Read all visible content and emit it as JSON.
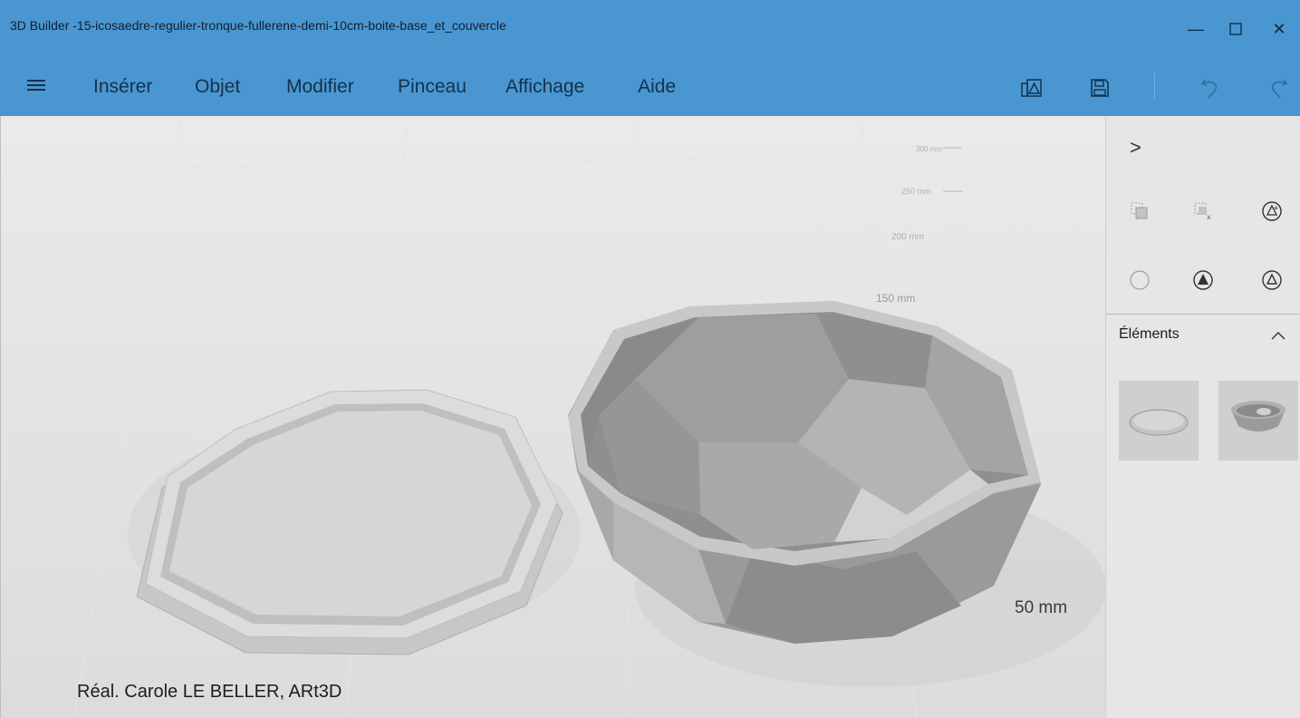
{
  "window": {
    "title": "3D Builder -15-icosaedre-regulier-tronque-fullerene-demi-10cm-boite-base_et_couvercle",
    "minimize_glyph": "—",
    "maximize_glyph": "☐",
    "close_glyph": "✕"
  },
  "menu": {
    "items": [
      {
        "label": "Insérer"
      },
      {
        "label": "Objet"
      },
      {
        "label": "Modifier"
      },
      {
        "label": "Pinceau"
      },
      {
        "label": "Affichage"
      },
      {
        "label": "Aide"
      }
    ],
    "tools": [
      "print-3d-icon",
      "save-icon",
      "undo-icon",
      "redo-icon"
    ]
  },
  "viewport": {
    "credit": "Réal. Carole LE BELLER, ARt3D",
    "scale_labels": [
      "300 mm",
      "250 mm",
      "200 mm",
      "150 mm",
      "50 mm"
    ]
  },
  "panel": {
    "collapse_glyph": ">",
    "elements_title": "Éléments",
    "element_items": [
      "lid-thumbnail",
      "bowl-thumbnail"
    ]
  },
  "colors": {
    "titlebar": "#4a96d1",
    "viewport_bg": "#ececec",
    "panel_bg": "#e6e6e6"
  }
}
